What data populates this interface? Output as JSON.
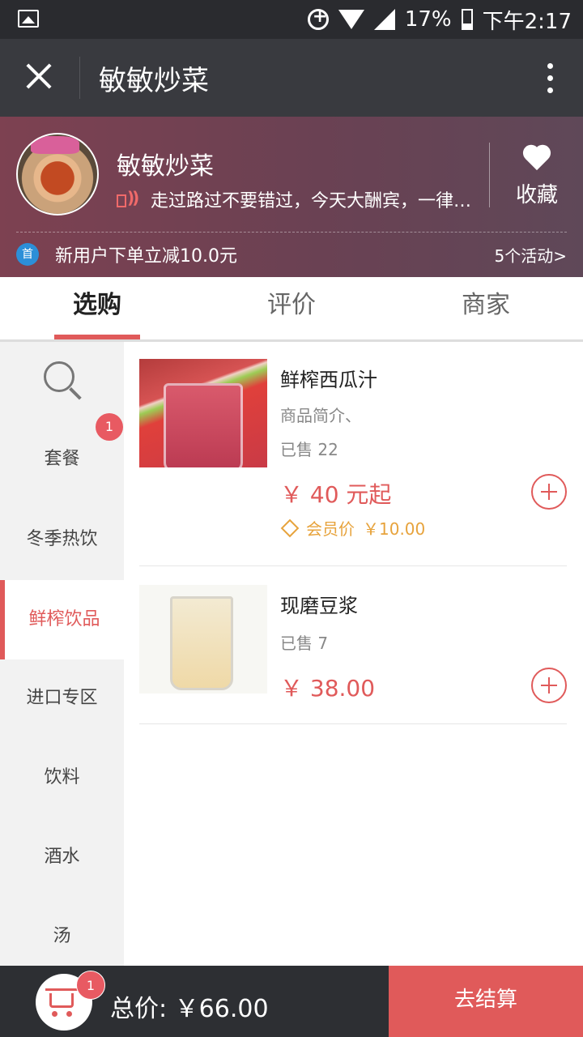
{
  "status_bar": {
    "battery": "17%",
    "time": "下午2:17"
  },
  "title_bar": {
    "title": "敏敏炒菜"
  },
  "shop": {
    "name": "敏敏炒菜",
    "notice": "走过路过不要错过，今天大酬宾，一律五折",
    "favorite_label": "收藏",
    "promo_badge": "首",
    "promo_text": "新用户下单立减10.0元",
    "activities": "5个活动>"
  },
  "tabs": [
    {
      "label": "选购",
      "active": true
    },
    {
      "label": "评价",
      "active": false
    },
    {
      "label": "商家",
      "active": false
    }
  ],
  "sidebar": {
    "badge": "1",
    "categories": [
      {
        "label": "套餐"
      },
      {
        "label": "冬季热饮"
      },
      {
        "label": "鲜榨饮品",
        "active": true
      },
      {
        "label": "进口专区"
      },
      {
        "label": "饮料"
      },
      {
        "label": "酒水"
      },
      {
        "label": "汤"
      }
    ]
  },
  "products": [
    {
      "name": "鲜榨西瓜汁",
      "desc": "商品简介、",
      "sold": "已售 22",
      "price": "￥ 40 元起",
      "member_label": "会员价",
      "member_price": "￥10.00"
    },
    {
      "name": "现磨豆浆",
      "sold": "已售 7",
      "price": "￥ 38.00"
    }
  ],
  "bottom": {
    "cart_badge": "1",
    "total": "总价: ￥66.00",
    "checkout": "去结算"
  },
  "colors": {
    "accent": "#e05a5a",
    "member": "#e7a33c",
    "titlebar": "#393a3f"
  }
}
